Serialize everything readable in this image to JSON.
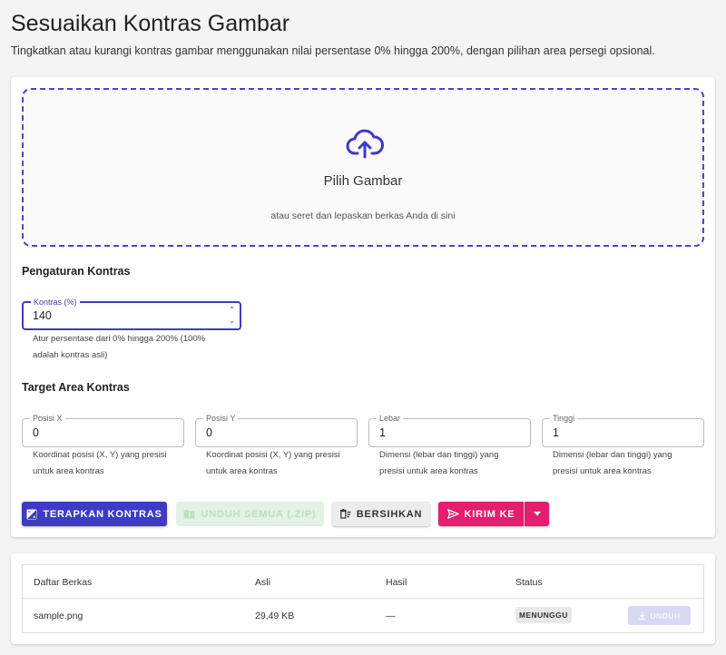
{
  "page": {
    "title": "Sesuaikan Kontras Gambar",
    "subtitle": "Tingkatkan atau kurangi kontras gambar menggunakan nilai persentase 0% hingga 200%, dengan pilihan area persegi opsional."
  },
  "dropzone": {
    "icon": "cloud-upload-icon",
    "title": "Pilih Gambar",
    "hint": "atau seret dan lepaskan berkas Anda di sini"
  },
  "contrast_settings": {
    "heading": "Pengaturan Kontras",
    "field_label": "Kontras (%)",
    "field_value": "140",
    "helper_line1": "Atur persentase dari 0% hingga 200% (100%",
    "helper_line2": "adalah kontras asli)"
  },
  "target_area": {
    "heading": "Target Area Kontras",
    "fields": [
      {
        "label": "Posisi X",
        "value": "0",
        "helper1": "Koordinat posisi (X, Y) yang presisi",
        "helper2": "untuk area kontras"
      },
      {
        "label": "Posisi Y",
        "value": "0",
        "helper1": "Koordinat posisi (X, Y) yang presisi",
        "helper2": "untuk area kontras"
      },
      {
        "label": "Lebar",
        "value": "1",
        "helper1": "Dimensi (lebar dan tinggi) yang",
        "helper2": "presisi untuk area kontras"
      },
      {
        "label": "Tinggi",
        "value": "1",
        "helper1": "Dimensi (lebar dan tinggi) yang",
        "helper2": "presisi untuk area kontras"
      }
    ]
  },
  "actions": {
    "apply": "TERAPKAN KONTRAS",
    "download_all": "UNDUH SEMUA (.ZIP)",
    "clear": "BERSIHKAN",
    "send_to": "KIRIM KE"
  },
  "file_table": {
    "headers": [
      "Daftar Berkas",
      "Asli",
      "Hasil",
      "Status"
    ],
    "rows": [
      {
        "name": "sample.png",
        "original": "29,49 KB",
        "result": "—",
        "status": "MENUNGGU",
        "action": "UNDUH"
      }
    ]
  },
  "colors": {
    "primary": "#3f3bc4",
    "accent": "#e51e6d",
    "disabled_success": "#e3f2e4"
  }
}
